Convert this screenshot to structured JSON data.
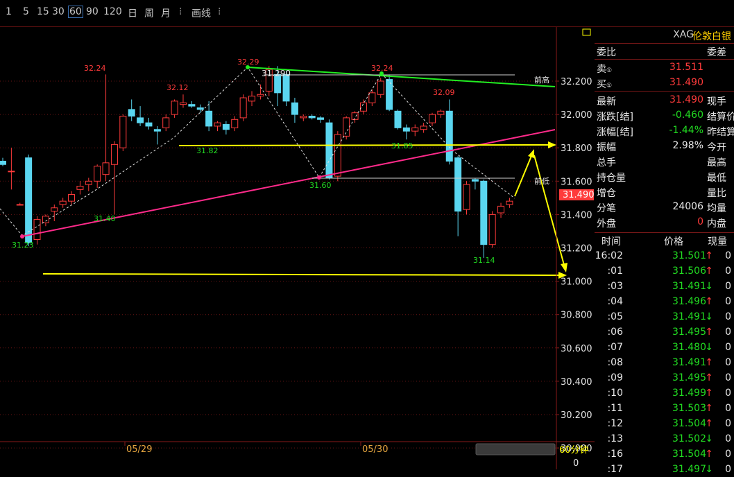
{
  "toolbar": {
    "periods": [
      "1",
      "5",
      "15",
      "30",
      "60",
      "90",
      "120",
      "日",
      "周",
      "月"
    ],
    "active": "60",
    "sep": "⁞",
    "draw_label": "画线"
  },
  "chart": {
    "period_label": "60分钟",
    "volume_axis_value": "0",
    "date_labels": [
      "05/29",
      "05/30"
    ],
    "current_price_tag": "31.490",
    "annotations": {
      "prev_high": "前高",
      "prev_low": "前低",
      "peak_labels": [
        "32.24",
        "32.12",
        "32.29",
        "32.24",
        "32.09"
      ],
      "trough_labels": [
        "31.82",
        "31.60",
        "31.85",
        "31.40",
        "31.23",
        "31.14"
      ],
      "line_value": "31.290"
    },
    "colors": {
      "up": "#ff3b3b",
      "down": "#5ad6f0",
      "support": "#ffff00",
      "trend_up": "#ff2a8a",
      "trend_down": "#22ee22"
    }
  },
  "chart_data": {
    "type": "candlestick",
    "y_ticks": [
      "32.200",
      "32.000",
      "31.800",
      "31.600",
      "31.400",
      "31.200",
      "31.000",
      "30.800",
      "30.600",
      "30.400",
      "30.200",
      "30.000"
    ],
    "ylim": [
      30.0,
      32.2
    ],
    "x_labels": [
      "05/29",
      "05/30"
    ],
    "candles": [
      {
        "o": 31.72,
        "h": 31.74,
        "l": 31.69,
        "c": 31.7
      },
      {
        "o": 31.66,
        "h": 31.8,
        "l": 31.55,
        "c": 31.66
      },
      {
        "o": 31.46,
        "h": 31.47,
        "l": 31.46,
        "c": 31.46
      },
      {
        "o": 31.74,
        "h": 31.76,
        "l": 31.21,
        "c": 31.23
      },
      {
        "o": 31.25,
        "h": 31.39,
        "l": 31.22,
        "c": 31.37
      },
      {
        "o": 31.35,
        "h": 31.4,
        "l": 31.33,
        "c": 31.39
      },
      {
        "o": 31.42,
        "h": 31.46,
        "l": 31.36,
        "c": 31.44
      },
      {
        "o": 31.46,
        "h": 31.5,
        "l": 31.44,
        "c": 31.48
      },
      {
        "o": 31.48,
        "h": 31.54,
        "l": 31.46,
        "c": 31.52
      },
      {
        "o": 31.55,
        "h": 31.6,
        "l": 31.52,
        "c": 31.57
      },
      {
        "o": 31.58,
        "h": 31.62,
        "l": 31.54,
        "c": 31.6
      },
      {
        "o": 31.6,
        "h": 31.7,
        "l": 31.56,
        "c": 31.69
      },
      {
        "o": 31.64,
        "h": 32.24,
        "l": 31.6,
        "c": 31.71
      },
      {
        "o": 31.7,
        "h": 31.84,
        "l": 31.4,
        "c": 31.82
      },
      {
        "o": 31.8,
        "h": 32.0,
        "l": 31.78,
        "c": 31.99
      },
      {
        "o": 32.03,
        "h": 32.09,
        "l": 31.96,
        "c": 31.99
      },
      {
        "o": 31.98,
        "h": 32.05,
        "l": 31.93,
        "c": 31.95
      },
      {
        "o": 31.95,
        "h": 31.98,
        "l": 31.91,
        "c": 31.93
      },
      {
        "o": 31.91,
        "h": 31.93,
        "l": 31.82,
        "c": 31.9
      },
      {
        "o": 31.92,
        "h": 32.0,
        "l": 31.9,
        "c": 31.98
      },
      {
        "o": 32.0,
        "h": 32.09,
        "l": 31.98,
        "c": 32.08
      },
      {
        "o": 32.06,
        "h": 32.12,
        "l": 32.04,
        "c": 32.07
      },
      {
        "o": 32.06,
        "h": 32.08,
        "l": 32.04,
        "c": 32.05
      },
      {
        "o": 32.04,
        "h": 32.06,
        "l": 32.01,
        "c": 32.03
      },
      {
        "o": 32.02,
        "h": 32.08,
        "l": 31.9,
        "c": 31.93
      },
      {
        "o": 31.93,
        "h": 31.96,
        "l": 31.9,
        "c": 31.95
      },
      {
        "o": 31.94,
        "h": 31.96,
        "l": 31.88,
        "c": 31.91
      },
      {
        "o": 31.92,
        "h": 31.99,
        "l": 31.9,
        "c": 31.97
      },
      {
        "o": 31.98,
        "h": 32.12,
        "l": 31.96,
        "c": 32.1
      },
      {
        "o": 32.08,
        "h": 32.14,
        "l": 32.05,
        "c": 32.11
      },
      {
        "o": 32.11,
        "h": 32.18,
        "l": 32.09,
        "c": 32.12
      },
      {
        "o": 32.14,
        "h": 32.29,
        "l": 32.11,
        "c": 32.27
      },
      {
        "o": 32.24,
        "h": 32.29,
        "l": 32.05,
        "c": 32.13
      },
      {
        "o": 32.24,
        "h": 32.26,
        "l": 32.05,
        "c": 32.08
      },
      {
        "o": 32.07,
        "h": 32.1,
        "l": 31.95,
        "c": 32.0
      },
      {
        "o": 31.98,
        "h": 32.0,
        "l": 31.96,
        "c": 31.99
      },
      {
        "o": 31.99,
        "h": 32.0,
        "l": 31.97,
        "c": 31.98
      },
      {
        "o": 31.98,
        "h": 31.99,
        "l": 31.95,
        "c": 31.97
      },
      {
        "o": 31.95,
        "h": 31.97,
        "l": 31.61,
        "c": 31.62
      },
      {
        "o": 31.63,
        "h": 31.9,
        "l": 31.6,
        "c": 31.88
      },
      {
        "o": 31.87,
        "h": 31.99,
        "l": 31.85,
        "c": 31.98
      },
      {
        "o": 31.97,
        "h": 32.02,
        "l": 31.95,
        "c": 32.01
      },
      {
        "o": 32.02,
        "h": 32.09,
        "l": 32.0,
        "c": 32.07
      },
      {
        "o": 32.07,
        "h": 32.15,
        "l": 32.05,
        "c": 32.13
      },
      {
        "o": 32.12,
        "h": 32.22,
        "l": 32.1,
        "c": 32.2
      },
      {
        "o": 32.21,
        "h": 32.24,
        "l": 32.02,
        "c": 32.03
      },
      {
        "o": 32.02,
        "h": 32.03,
        "l": 31.91,
        "c": 31.92
      },
      {
        "o": 31.92,
        "h": 31.94,
        "l": 31.85,
        "c": 31.9
      },
      {
        "o": 31.9,
        "h": 31.94,
        "l": 31.87,
        "c": 31.92
      },
      {
        "o": 31.91,
        "h": 31.95,
        "l": 31.89,
        "c": 31.93
      },
      {
        "o": 31.95,
        "h": 32.01,
        "l": 31.93,
        "c": 32.0
      },
      {
        "o": 32.0,
        "h": 32.03,
        "l": 31.98,
        "c": 32.02
      },
      {
        "o": 32.02,
        "h": 32.09,
        "l": 31.7,
        "c": 31.72
      },
      {
        "o": 31.74,
        "h": 31.75,
        "l": 31.27,
        "c": 31.42
      },
      {
        "o": 31.43,
        "h": 31.6,
        "l": 31.4,
        "c": 31.58
      },
      {
        "o": 31.61,
        "h": 31.62,
        "l": 31.55,
        "c": 31.6
      },
      {
        "o": 31.6,
        "h": 31.61,
        "l": 31.14,
        "c": 31.22
      },
      {
        "o": 31.22,
        "h": 31.42,
        "l": 31.2,
        "c": 31.4
      },
      {
        "o": 31.41,
        "h": 31.47,
        "l": 31.38,
        "c": 31.45
      },
      {
        "o": 31.46,
        "h": 31.5,
        "l": 31.44,
        "c": 31.48
      }
    ]
  },
  "panel": {
    "title_code": "XAG",
    "title_name": "伦敦白银",
    "weibi_label": "委比",
    "weicha_label": "委差",
    "sell": {
      "label": "卖",
      "value": "31.511"
    },
    "buy": {
      "label": "买",
      "value": "31.490"
    },
    "rows": [
      {
        "k": "最新",
        "v": "31.490",
        "c": "red",
        "k2": "现手"
      },
      {
        "k": "涨跌[结]",
        "v": "-0.460",
        "c": "green",
        "k2": "结算价"
      },
      {
        "k": "涨幅[结]",
        "v": "-1.44%",
        "c": "green",
        "k2": "昨结算"
      },
      {
        "k": "振幅",
        "v": "2.98%",
        "c": "white",
        "k2": "今开"
      },
      {
        "k": "总手",
        "v": "",
        "c": "white",
        "k2": "最高"
      },
      {
        "k": "持仓量",
        "v": "",
        "c": "white",
        "k2": "最低"
      },
      {
        "k": "增仓",
        "v": "",
        "c": "white",
        "k2": "量比"
      },
      {
        "k": "分笔",
        "v": "24006",
        "c": "white",
        "k2": "均量"
      },
      {
        "k": "外盘",
        "v": "0",
        "c": "red",
        "k2": "内盘"
      }
    ],
    "tick_headers": [
      "时间",
      "价格",
      "现量"
    ],
    "ticks": [
      {
        "t": "16:02",
        "p": "31.501",
        "a": "↑",
        "v": "0"
      },
      {
        "t": ":01",
        "p": "31.506",
        "a": "↑",
        "v": "0"
      },
      {
        "t": ":03",
        "p": "31.491",
        "a": "↓",
        "v": "0"
      },
      {
        "t": ":04",
        "p": "31.496",
        "a": "↑",
        "v": "0"
      },
      {
        "t": ":05",
        "p": "31.491",
        "a": "↓",
        "v": "0"
      },
      {
        "t": ":06",
        "p": "31.495",
        "a": "↑",
        "v": "0"
      },
      {
        "t": ":07",
        "p": "31.480",
        "a": "↓",
        "v": "0"
      },
      {
        "t": ":08",
        "p": "31.491",
        "a": "↑",
        "v": "0"
      },
      {
        "t": ":09",
        "p": "31.495",
        "a": "↑",
        "v": "0"
      },
      {
        "t": ":10",
        "p": "31.499",
        "a": "↑",
        "v": "0"
      },
      {
        "t": ":11",
        "p": "31.503",
        "a": "↑",
        "v": "0"
      },
      {
        "t": ":12",
        "p": "31.504",
        "a": "↑",
        "v": "0"
      },
      {
        "t": ":13",
        "p": "31.502",
        "a": "↓",
        "v": "0"
      },
      {
        "t": ":16",
        "p": "31.504",
        "a": "↑",
        "v": "0"
      },
      {
        "t": ":17",
        "p": "31.497",
        "a": "↓",
        "v": "0"
      }
    ]
  }
}
